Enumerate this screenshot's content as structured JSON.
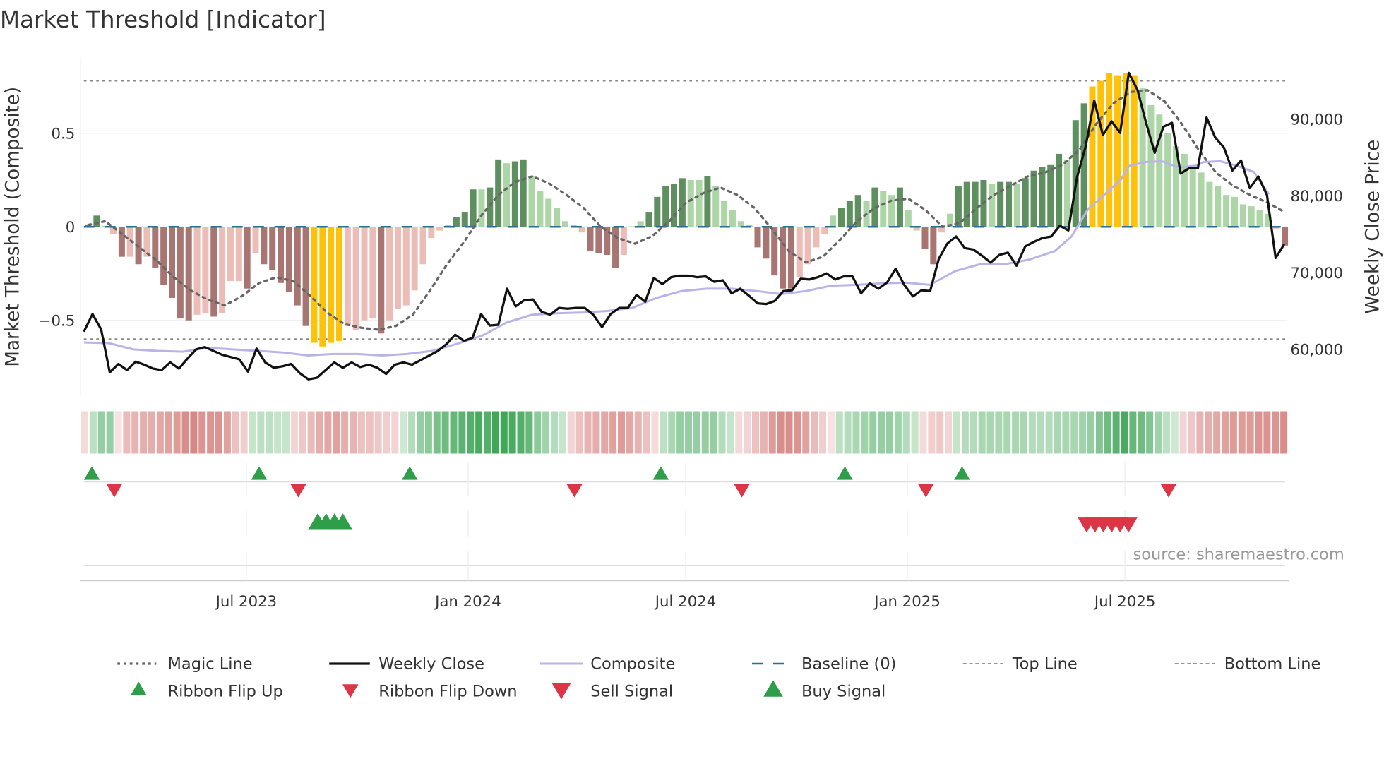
{
  "title": "Market Threshold [Indicator]",
  "source": "source: sharemaestro.com",
  "colors": {
    "dark_green": "#5e8f5e",
    "light_green": "#acd6a6",
    "dark_red": "#a97572",
    "light_red": "#ecbcb7",
    "yellow": "#ffc20a",
    "close": "#111111",
    "composite": "#b9b3e8",
    "magic": "#666666",
    "baseline": "#2a6f97",
    "threshold": "#888888",
    "buy": "#2e9e48",
    "sell": "#dc3545"
  },
  "chart_data": {
    "type": "bar+line",
    "title": "Market Threshold [Indicator]",
    "ylabel_left": "Market Threshold (Composite)",
    "ylabel_right": "Weekly Close Price",
    "ylim_left": [
      -0.85,
      0.9
    ],
    "ylim_right": [
      55000,
      96000
    ],
    "yticks_left": [
      {
        "v": 0.5,
        "label": "0.5"
      },
      {
        "v": 0,
        "label": "0"
      },
      {
        "v": -0.5,
        "label": "−0.5"
      }
    ],
    "yticks_right": [
      {
        "v": 90000,
        "label": "90,000"
      },
      {
        "v": 80000,
        "label": "80,000"
      },
      {
        "v": 70000,
        "label": "70,000"
      },
      {
        "v": 60000,
        "label": "60,000"
      }
    ],
    "xticks": [
      {
        "week": 19,
        "label": "Jul 2023"
      },
      {
        "week": 45.5,
        "label": "Jan 2024"
      },
      {
        "week": 71.5,
        "label": "Jul 2024"
      },
      {
        "week": 98,
        "label": "Jan 2025"
      },
      {
        "week": 124,
        "label": "Jul 2025"
      }
    ],
    "top_line": 0.78,
    "bottom_line": -0.6,
    "baseline": 0,
    "bars": [
      [
        0.01,
        "dg"
      ],
      [
        0.06,
        "dg"
      ],
      [
        0.005,
        "lg"
      ],
      [
        -0.04,
        "lr"
      ],
      [
        -0.16,
        "dr"
      ],
      [
        -0.16,
        "lr"
      ],
      [
        -0.2,
        "dr"
      ],
      [
        -0.16,
        "lr"
      ],
      [
        -0.22,
        "dr"
      ],
      [
        -0.31,
        "dr"
      ],
      [
        -0.38,
        "dr"
      ],
      [
        -0.49,
        "dr"
      ],
      [
        -0.5,
        "dr"
      ],
      [
        -0.47,
        "lr"
      ],
      [
        -0.46,
        "lr"
      ],
      [
        -0.48,
        "dr"
      ],
      [
        -0.46,
        "lr"
      ],
      [
        -0.29,
        "lr"
      ],
      [
        -0.29,
        "lr"
      ],
      [
        -0.33,
        "dr"
      ],
      [
        -0.14,
        "lr"
      ],
      [
        -0.2,
        "dr"
      ],
      [
        -0.23,
        "dr"
      ],
      [
        -0.3,
        "dr"
      ],
      [
        -0.35,
        "dr"
      ],
      [
        -0.42,
        "dr"
      ],
      [
        -0.53,
        "dr"
      ],
      [
        -0.62,
        "y"
      ],
      [
        -0.64,
        "y"
      ],
      [
        -0.62,
        "y"
      ],
      [
        -0.61,
        "y"
      ],
      [
        -0.53,
        "lr"
      ],
      [
        -0.55,
        "lr"
      ],
      [
        -0.5,
        "lr"
      ],
      [
        -0.49,
        "lr"
      ],
      [
        -0.57,
        "dr"
      ],
      [
        -0.5,
        "lr"
      ],
      [
        -0.44,
        "lr"
      ],
      [
        -0.42,
        "lr"
      ],
      [
        -0.34,
        "lr"
      ],
      [
        -0.2,
        "lr"
      ],
      [
        -0.06,
        "lr"
      ],
      [
        -0.02,
        "lr"
      ],
      [
        0.01,
        "lg"
      ],
      [
        0.05,
        "dg"
      ],
      [
        0.08,
        "dg"
      ],
      [
        0.2,
        "dg"
      ],
      [
        0.2,
        "lg"
      ],
      [
        0.21,
        "dg"
      ],
      [
        0.36,
        "dg"
      ],
      [
        0.34,
        "lg"
      ],
      [
        0.35,
        "dg"
      ],
      [
        0.36,
        "dg"
      ],
      [
        0.27,
        "lg"
      ],
      [
        0.19,
        "lg"
      ],
      [
        0.15,
        "lg"
      ],
      [
        0.1,
        "lg"
      ],
      [
        0.03,
        "lg"
      ],
      [
        0.01,
        "lg"
      ],
      [
        -0.03,
        "lr"
      ],
      [
        -0.13,
        "dr"
      ],
      [
        -0.14,
        "dr"
      ],
      [
        -0.15,
        "dr"
      ],
      [
        -0.22,
        "dr"
      ],
      [
        -0.15,
        "lr"
      ],
      [
        0.003,
        "lg"
      ],
      [
        0.03,
        "lg"
      ],
      [
        0.08,
        "dg"
      ],
      [
        0.16,
        "dg"
      ],
      [
        0.22,
        "dg"
      ],
      [
        0.23,
        "dg"
      ],
      [
        0.26,
        "dg"
      ],
      [
        0.25,
        "lg"
      ],
      [
        0.25,
        "lg"
      ],
      [
        0.27,
        "dg"
      ],
      [
        0.22,
        "lg"
      ],
      [
        0.14,
        "lg"
      ],
      [
        0.09,
        "lg"
      ],
      [
        0.03,
        "lg"
      ],
      [
        0.01,
        "lg"
      ],
      [
        -0.11,
        "dr"
      ],
      [
        -0.17,
        "dr"
      ],
      [
        -0.26,
        "dr"
      ],
      [
        -0.33,
        "dr"
      ],
      [
        -0.33,
        "dr"
      ],
      [
        -0.27,
        "lr"
      ],
      [
        -0.2,
        "lr"
      ],
      [
        -0.11,
        "lr"
      ],
      [
        -0.04,
        "lr"
      ],
      [
        0.06,
        "lg"
      ],
      [
        0.1,
        "dg"
      ],
      [
        0.14,
        "dg"
      ],
      [
        0.17,
        "dg"
      ],
      [
        0.14,
        "lg"
      ],
      [
        0.21,
        "dg"
      ],
      [
        0.19,
        "lg"
      ],
      [
        0.17,
        "lg"
      ],
      [
        0.21,
        "dg"
      ],
      [
        0.09,
        "lg"
      ],
      [
        -0.02,
        "lr"
      ],
      [
        -0.12,
        "dr"
      ],
      [
        -0.2,
        "dr"
      ],
      [
        -0.03,
        "lr"
      ],
      [
        0.07,
        "lg"
      ],
      [
        0.22,
        "dg"
      ],
      [
        0.24,
        "dg"
      ],
      [
        0.24,
        "dg"
      ],
      [
        0.25,
        "dg"
      ],
      [
        0.23,
        "lg"
      ],
      [
        0.24,
        "dg"
      ],
      [
        0.24,
        "dg"
      ],
      [
        0.23,
        "lg"
      ],
      [
        0.26,
        "dg"
      ],
      [
        0.3,
        "dg"
      ],
      [
        0.32,
        "dg"
      ],
      [
        0.33,
        "dg"
      ],
      [
        0.39,
        "dg"
      ],
      [
        0.36,
        "lg"
      ],
      [
        0.57,
        "dg"
      ],
      [
        0.66,
        "dg"
      ],
      [
        0.75,
        "y"
      ],
      [
        0.78,
        "y"
      ],
      [
        0.82,
        "y"
      ],
      [
        0.81,
        "y"
      ],
      [
        0.82,
        "y"
      ],
      [
        0.81,
        "y"
      ],
      [
        0.74,
        "lg"
      ],
      [
        0.65,
        "lg"
      ],
      [
        0.6,
        "lg"
      ],
      [
        0.5,
        "lg"
      ],
      [
        0.43,
        "lg"
      ],
      [
        0.39,
        "lg"
      ],
      [
        0.33,
        "lg"
      ],
      [
        0.29,
        "lg"
      ],
      [
        0.24,
        "lg"
      ],
      [
        0.22,
        "lg"
      ],
      [
        0.17,
        "lg"
      ],
      [
        0.16,
        "lg"
      ],
      [
        0.12,
        "lg"
      ],
      [
        0.11,
        "lg"
      ],
      [
        0.09,
        "lg"
      ],
      [
        0.07,
        "lg"
      ],
      [
        -0.01,
        "lr"
      ],
      [
        -0.1,
        "dr"
      ]
    ],
    "magic_line": [
      0.01,
      0.03,
      -0.04,
      -0.11,
      -0.18,
      -0.27,
      -0.34,
      -0.39,
      -0.42,
      -0.37,
      -0.3,
      -0.27,
      -0.29,
      -0.37,
      -0.46,
      -0.52,
      -0.54,
      -0.55,
      -0.53,
      -0.47,
      -0.34,
      -0.2,
      -0.08,
      0.06,
      0.17,
      0.24,
      0.27,
      0.23,
      0.17,
      0.1,
      0,
      -0.06,
      -0.09,
      -0.05,
      0.03,
      0.13,
      0.18,
      0.21,
      0.17,
      0.1,
      -0.01,
      -0.13,
      -0.19,
      -0.16,
      -0.07,
      0.03,
      0.1,
      0.14,
      0.15,
      0.09,
      0,
      0.02,
      0.1,
      0.17,
      0.22,
      0.27,
      0.29,
      0.33,
      0.41,
      0.55,
      0.66,
      0.72,
      0.73,
      0.67,
      0.55,
      0.41,
      0.29,
      0.22,
      0.17,
      0.13,
      0.08
    ],
    "weekly_close": [
      62200,
      64500,
      62500,
      56900,
      58000,
      57200,
      58300,
      57900,
      57400,
      57200,
      58200,
      57400,
      58700,
      59900,
      60200,
      59700,
      59200,
      58900,
      58600,
      57000,
      60000,
      58200,
      57500,
      57700,
      58000,
      56800,
      56000,
      56200,
      57200,
      58200,
      57500,
      58200,
      57600,
      57900,
      57500,
      56700,
      57900,
      58200,
      57900,
      58500,
      59100,
      59700,
      60600,
      61800,
      61000,
      61400,
      64500,
      63000,
      63100,
      67800,
      65500,
      66300,
      66400,
      64800,
      64400,
      65300,
      65200,
      65300,
      65300,
      64400,
      62800,
      64500,
      65300,
      65300,
      67000,
      66100,
      69200,
      68400,
      69300,
      69500,
      69500,
      69300,
      69400,
      68700,
      68900,
      67200,
      67800,
      66900,
      65900,
      65800,
      66200,
      67500,
      67600,
      69100,
      69000,
      69300,
      69800,
      69000,
      69400,
      69400,
      67200,
      68500,
      67800,
      68600,
      70400,
      68300,
      66800,
      67600,
      67500,
      71700,
      73700,
      74600,
      73100,
      72900,
      72100,
      71200,
      72200,
      72500,
      70800,
      73300,
      73900,
      74400,
      74600,
      76000,
      75400,
      82300,
      86300,
      92300,
      87800,
      89600,
      88100,
      95900,
      93700,
      89400,
      85500,
      88900,
      89400,
      82800,
      83500,
      83500,
      90100,
      87500,
      86200,
      83200,
      84500,
      80900,
      82400,
      80000,
      71800,
      73600
    ],
    "composite": [
      [
        -0.5,
        60800
      ],
      [
        2.5,
        60700
      ],
      [
        5.4,
        59900
      ],
      [
        8.3,
        59700
      ],
      [
        11.3,
        59600
      ],
      [
        14.3,
        60100
      ],
      [
        17.3,
        59900
      ],
      [
        20.3,
        59700
      ],
      [
        23.2,
        59500
      ],
      [
        26.3,
        59100
      ],
      [
        29.2,
        59300
      ],
      [
        32.2,
        59300
      ],
      [
        35.1,
        59100
      ],
      [
        38.1,
        59300
      ],
      [
        41.1,
        59700
      ],
      [
        44,
        60600
      ],
      [
        47.1,
        61700
      ],
      [
        50,
        63400
      ],
      [
        53,
        64400
      ],
      [
        56,
        64600
      ],
      [
        59.1,
        64700
      ],
      [
        62,
        64900
      ],
      [
        65,
        65300
      ],
      [
        67.9,
        66600
      ],
      [
        70.9,
        67500
      ],
      [
        73.9,
        67800
      ],
      [
        76.9,
        67800
      ],
      [
        79.9,
        67500
      ],
      [
        82.8,
        67100
      ],
      [
        85.8,
        67500
      ],
      [
        88.8,
        68200
      ],
      [
        91.8,
        68300
      ],
      [
        94.7,
        68500
      ],
      [
        97.7,
        68600
      ],
      [
        100.6,
        68300
      ],
      [
        103.6,
        70100
      ],
      [
        106.6,
        71000
      ],
      [
        109.6,
        71000
      ],
      [
        112.5,
        71600
      ],
      [
        115.5,
        72700
      ],
      [
        117.5,
        74600
      ],
      [
        119.5,
        78200
      ],
      [
        121.5,
        80100
      ],
      [
        123.4,
        82000
      ],
      [
        124.4,
        83800
      ],
      [
        126.4,
        84300
      ],
      [
        128.3,
        84400
      ],
      [
        130.3,
        83600
      ],
      [
        132.3,
        83800
      ],
      [
        133.3,
        84300
      ],
      [
        135.3,
        84400
      ],
      [
        137.3,
        83800
      ],
      [
        139.3,
        83000
      ],
      [
        141.1,
        80100
      ]
    ],
    "ribbon": [
      -0.15,
      0.3,
      0.5,
      0.5,
      -0.1,
      -0.4,
      -0.45,
      -0.5,
      -0.5,
      -0.55,
      -0.6,
      -0.65,
      -0.75,
      -0.8,
      -0.7,
      -0.7,
      -0.7,
      -0.6,
      -0.35,
      -0.25,
      0.25,
      0.3,
      0.3,
      0.25,
      0.25,
      -0.2,
      -0.3,
      -0.4,
      -0.5,
      -0.55,
      -0.6,
      -0.5,
      -0.45,
      -0.35,
      -0.35,
      -0.3,
      -0.25,
      -0.2,
      0.2,
      0.35,
      0.5,
      0.55,
      0.65,
      0.7,
      0.75,
      0.8,
      0.85,
      0.9,
      0.85,
      0.95,
      0.95,
      0.9,
      0.85,
      0.75,
      0.55,
      0.45,
      0.35,
      0.25,
      -0.2,
      -0.35,
      -0.45,
      -0.5,
      -0.55,
      -0.6,
      -0.65,
      -0.55,
      -0.45,
      -0.35,
      -0.15,
      0.3,
      0.4,
      0.5,
      0.5,
      0.5,
      0.5,
      0.5,
      0.35,
      0.25,
      -0.15,
      -0.2,
      -0.35,
      -0.45,
      -0.65,
      -0.75,
      -0.75,
      -0.7,
      -0.6,
      -0.4,
      -0.25,
      -0.1,
      0.3,
      0.35,
      0.4,
      0.45,
      0.5,
      0.5,
      0.5,
      0.45,
      0.35,
      0.25,
      -0.15,
      -0.25,
      -0.3,
      -0.2,
      0.25,
      0.35,
      0.35,
      0.4,
      0.4,
      0.4,
      0.4,
      0.4,
      0.4,
      0.35,
      0.35,
      0.35,
      0.4,
      0.4,
      0.4,
      0.45,
      0.5,
      0.6,
      0.7,
      0.8,
      0.9,
      0.75,
      0.7,
      0.6,
      0.45,
      0.3,
      0.2,
      -0.2,
      -0.3,
      -0.45,
      -0.5,
      -0.55,
      -0.6,
      -0.65,
      -0.65,
      -0.65,
      -0.7,
      -0.7,
      -0.7,
      -0.75
    ],
    "ribbon_flip_up_weeks": [
      0,
      20,
      38,
      68,
      90,
      104
    ],
    "ribbon_flip_down_weeks": [
      3,
      25,
      58,
      78,
      100,
      129
    ],
    "buy_signal_weeks": [
      27,
      28,
      29,
      30
    ],
    "sell_signal_weeks": [
      119,
      120,
      121,
      122,
      123,
      124
    ],
    "legend": {
      "placement": "bottom",
      "items": [
        {
          "label": "Magic Line",
          "kind": "dotted"
        },
        {
          "label": "Weekly Close",
          "kind": "close"
        },
        {
          "label": "Composite",
          "kind": "composite"
        },
        {
          "label": "Baseline (0)",
          "kind": "baseline"
        },
        {
          "label": "Top Line",
          "kind": "threshold"
        },
        {
          "label": "Bottom Line",
          "kind": "threshold"
        },
        {
          "label": "Ribbon Flip Up",
          "kind": "flipup"
        },
        {
          "label": "Ribbon Flip Down",
          "kind": "flipdown"
        },
        {
          "label": "Sell Signal",
          "kind": "sell"
        },
        {
          "label": "Buy Signal",
          "kind": "buy"
        }
      ]
    }
  }
}
